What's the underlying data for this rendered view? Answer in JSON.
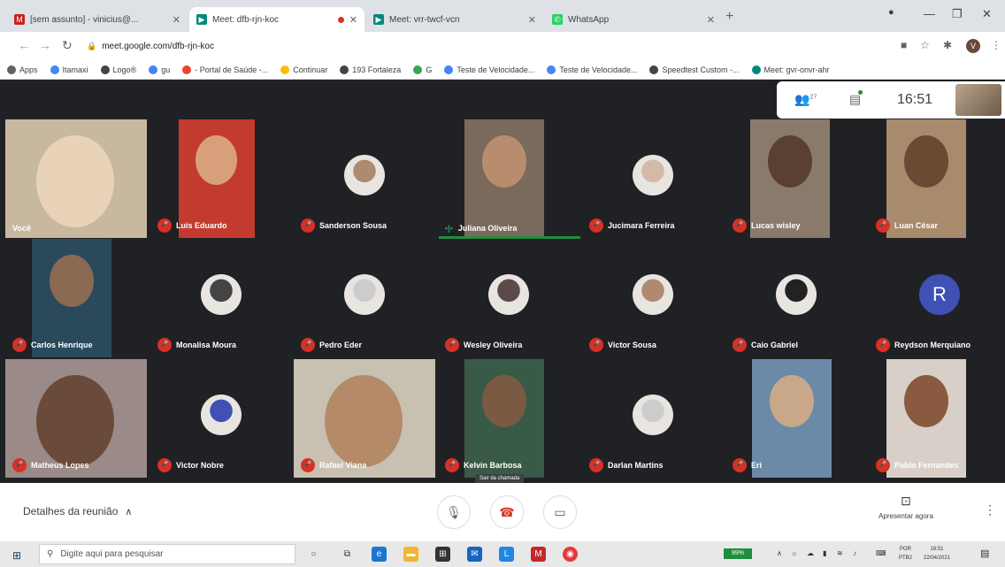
{
  "browser": {
    "tabs": [
      {
        "label": "[sem assunto] - vinicius@...",
        "icon": "gmail-icon",
        "color": "#c5221f"
      },
      {
        "label": "Meet: dfb-rjn-koc",
        "icon": "meet-icon",
        "color": "#00897b",
        "recording": true
      },
      {
        "label": "Meet: vrr-twcf-vcn",
        "icon": "meet-icon",
        "color": "#00897b"
      },
      {
        "label": "WhatsApp",
        "icon": "whatsapp-icon",
        "color": "#25d366"
      }
    ],
    "url": "meet.google.com/dfb-rjn-koc",
    "bookmarks": [
      {
        "label": "Apps",
        "color": "#5f6368"
      },
      {
        "label": "Itamaxi",
        "color": "#4285f4"
      },
      {
        "label": "Logo®",
        "color": "#444"
      },
      {
        "label": "gu",
        "color": "#4285f4"
      },
      {
        "label": "- Portal de Saúde -...",
        "color": "#ea4335"
      },
      {
        "label": "Continuar",
        "color": "#fbbc04"
      },
      {
        "label": "193 Fortaleza",
        "color": "#444"
      },
      {
        "label": "G",
        "color": "#34a853"
      },
      {
        "label": "Teste de Velocidade...",
        "color": "#4285f4"
      },
      {
        "label": "Teste de Velocidade...",
        "color": "#4285f4"
      },
      {
        "label": "Speedtest Custom -...",
        "color": "#444"
      },
      {
        "label": "Meet: gvr-onvr-ahr",
        "color": "#00897b"
      }
    ]
  },
  "meet": {
    "participant_count": "27",
    "time": "16:51",
    "participants": [
      {
        "name": "Você",
        "muted": false,
        "type": "video"
      },
      {
        "name": "Luis Eduardo",
        "muted": true,
        "type": "video"
      },
      {
        "name": "Sanderson Sousa",
        "muted": true,
        "type": "avatar"
      },
      {
        "name": "Juliana Oliveira",
        "muted": false,
        "type": "video",
        "speaking": true
      },
      {
        "name": "Jucimara Ferreira",
        "muted": true,
        "type": "avatar"
      },
      {
        "name": "Lucas wisley",
        "muted": true,
        "type": "video"
      },
      {
        "name": "Luan César",
        "muted": true,
        "type": "video"
      },
      {
        "name": "Carlos Henrique",
        "muted": true,
        "type": "video"
      },
      {
        "name": "Monalisa Moura",
        "muted": true,
        "type": "avatar"
      },
      {
        "name": "Pedro Eder",
        "muted": true,
        "type": "avatar"
      },
      {
        "name": "Wesley Oliveira",
        "muted": true,
        "type": "avatar"
      },
      {
        "name": "Victor Sousa",
        "muted": true,
        "type": "avatar"
      },
      {
        "name": "Caio Gabriel",
        "muted": true,
        "type": "avatar"
      },
      {
        "name": "Reydson Merquiano",
        "muted": true,
        "type": "letter",
        "letter": "R"
      },
      {
        "name": "Matheus Lopes",
        "muted": true,
        "type": "video"
      },
      {
        "name": "Victor Nobre",
        "muted": true,
        "type": "avatar"
      },
      {
        "name": "Rafael Viana",
        "muted": true,
        "type": "video"
      },
      {
        "name": "Kelvin Barbosa",
        "muted": true,
        "type": "video"
      },
      {
        "name": "Darlan Martins",
        "muted": true,
        "type": "avatar"
      },
      {
        "name": "Eri",
        "muted": true,
        "type": "video"
      },
      {
        "name": "Pablo Fernandes",
        "muted": true,
        "type": "video"
      }
    ],
    "details_label": "Detalhes da reunião",
    "end_tooltip": "Sair da chamada",
    "present_label": "Apresentar agora"
  },
  "taskbar": {
    "search_placeholder": "Digite aqui para pesquisar",
    "lang_line1": "POR",
    "lang_line2": "PTB2",
    "time": "16:51",
    "date": "22/04/2021",
    "battery": "99%"
  }
}
